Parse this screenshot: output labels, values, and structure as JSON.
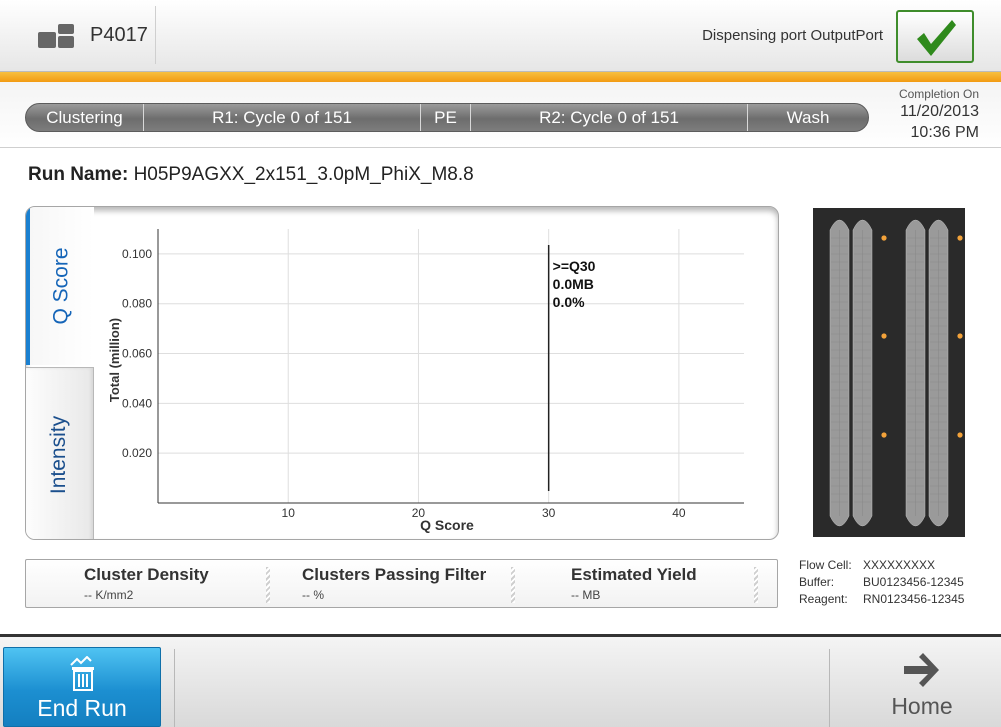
{
  "header": {
    "instrument_id": "P4017",
    "port_label": "Dispensing port OutputPort",
    "icons": {
      "instrument": "instrument-icon",
      "status": "checkmark-icon"
    },
    "status_color": "#3f8d2c"
  },
  "progress": {
    "steps": [
      "Clustering",
      "R1: Cycle 0 of 151",
      "PE",
      "R2: Cycle 0 of 151",
      "Wash"
    ],
    "completion_label": "Completion On",
    "completion_date": "11/20/2013",
    "completion_time": "10:36 PM"
  },
  "run": {
    "label": "Run Name:",
    "name": "H05P9AGXX_2x151_3.0pM_PhiX_M8.8"
  },
  "tabs": {
    "qscore": "Q Score",
    "intensity": "Intensity",
    "active": "qscore"
  },
  "chart_data": {
    "type": "bar",
    "xlabel": "Q Score",
    "ylabel": "Total (million)",
    "xlim": [
      0,
      45
    ],
    "ylim": [
      0,
      0.11
    ],
    "x_ticks": [
      10,
      20,
      30,
      40
    ],
    "y_ticks": [
      0.02,
      0.04,
      0.06,
      0.08,
      0.1
    ],
    "y_tick_labels": [
      "0.020",
      "0.040",
      "0.060",
      "0.080",
      "0.100"
    ],
    "grid": true,
    "threshold": {
      "x": 30,
      "label": ">=Q30",
      "yield": "0.0MB",
      "percent": "0.0%"
    },
    "series": []
  },
  "metrics": [
    {
      "title": "Cluster Density",
      "value": "-- K/mm2"
    },
    {
      "title": "Clusters Passing Filter",
      "value": "-- %"
    },
    {
      "title": "Estimated Yield",
      "value": "-- MB"
    }
  ],
  "info": {
    "flow_cell_label": "Flow Cell:",
    "flow_cell": "XXXXXXXXX",
    "buffer_label": "Buffer:",
    "buffer": "BU0123456-12345",
    "reagent_label": "Reagent:",
    "reagent": "RN0123456-12345"
  },
  "footer": {
    "end_run_label": "End Run",
    "home_label": "Home",
    "icons": {
      "end_run": "trash-icon",
      "home": "arrow-right-icon"
    },
    "accent_color": "#1c8fd1"
  }
}
